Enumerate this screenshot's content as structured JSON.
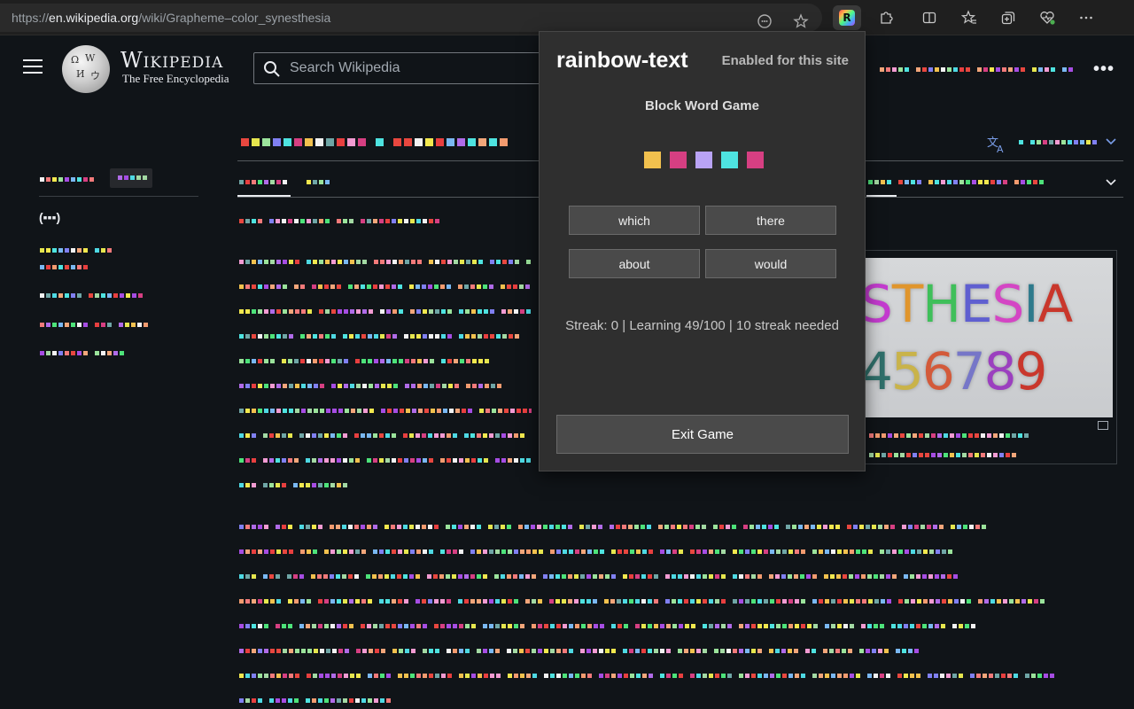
{
  "browser": {
    "url_prefix": "https://",
    "url_host": "en.wikipedia.org",
    "url_path": "/wiki/Grapheme–color_synesthesia",
    "icons": [
      "site-info-icon",
      "favorite-star-icon",
      "rainbow-text-extension-icon",
      "extensions-puzzle-icon",
      "split-screen-icon",
      "favorites-icon",
      "collections-icon",
      "browser-essentials-icon",
      "menu-more-icon"
    ]
  },
  "wikipedia": {
    "wordmark": "Wikipedia",
    "tagline": "The Free Encyclopedia",
    "search_placeholder": "Search Wikipedia",
    "toc_top": "(▪▪▪)",
    "infobox_image_text_line1": "STHESIA",
    "infobox_image_text_line2": "456789",
    "infobox_letter_colors": [
      "#c43bcf",
      "#e0952c",
      "#3fbf5a",
      "#5f5fd0",
      "#d445c4",
      "#2e7a8c",
      "#c9372c"
    ],
    "infobox_digit_colors": [
      "#2f6f6a",
      "#c9b34a",
      "#d35a3a",
      "#7676c8",
      "#9b3fbf",
      "#c9372c"
    ]
  },
  "extension": {
    "name": "rainbow-text",
    "status": "Enabled for this site",
    "game_title": "Block Word Game",
    "word_block_colors": [
      "#f2c14e",
      "#d63f82",
      "#b9a3f5",
      "#4ee3e0",
      "#d63f82"
    ],
    "choices": [
      "which",
      "there",
      "about",
      "would"
    ],
    "stats": "Streak: 0 | Learning 49/100 | 10 streak needed",
    "exit_label": "Exit Game"
  },
  "palette": [
    "#4de37a",
    "#e8473f",
    "#f29bd2",
    "#a64de3",
    "#d63f82",
    "#9be39b",
    "#b06be8",
    "#a3d9a3",
    "#f2f2f2",
    "#4ee3e0",
    "#f2a67a",
    "#f27a7a",
    "#f2c14e",
    "#e83f3f",
    "#f2e84e",
    "#6fa6a6",
    "#4ed9e3",
    "#f29b6f",
    "#8080f2",
    "#e6e64e",
    "#7ab8f2"
  ]
}
